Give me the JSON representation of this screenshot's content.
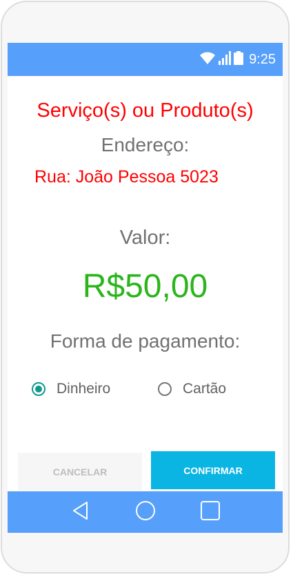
{
  "status_bar": {
    "time": "9:25",
    "icons": [
      "wifi-icon",
      "signal-icon",
      "battery-icon"
    ],
    "color": "#56a0fb"
  },
  "order": {
    "title": "Serviço(s) ou Produto(s)",
    "address_label": "Endereço:",
    "address_value": "Rua: João Pessoa 5023",
    "value_label": "Valor:",
    "value_amount": "R$50,00"
  },
  "payment": {
    "label": "Forma de pagamento:",
    "options": [
      {
        "label": "Dinheiro",
        "selected": true
      },
      {
        "label": "Cartão",
        "selected": false
      }
    ]
  },
  "actions": {
    "cancel_label": "CANCELAR",
    "confirm_label": "CONFIRMAR"
  },
  "nav_bar": {
    "icons": [
      "back-icon",
      "home-icon",
      "recents-icon"
    ]
  },
  "colors": {
    "accent_blue": "#56a0fb",
    "title_red": "#ff0000",
    "value_green": "#2bb51b",
    "radio_teal": "#0f9a8e",
    "confirm_cyan": "#0ab4e3"
  }
}
